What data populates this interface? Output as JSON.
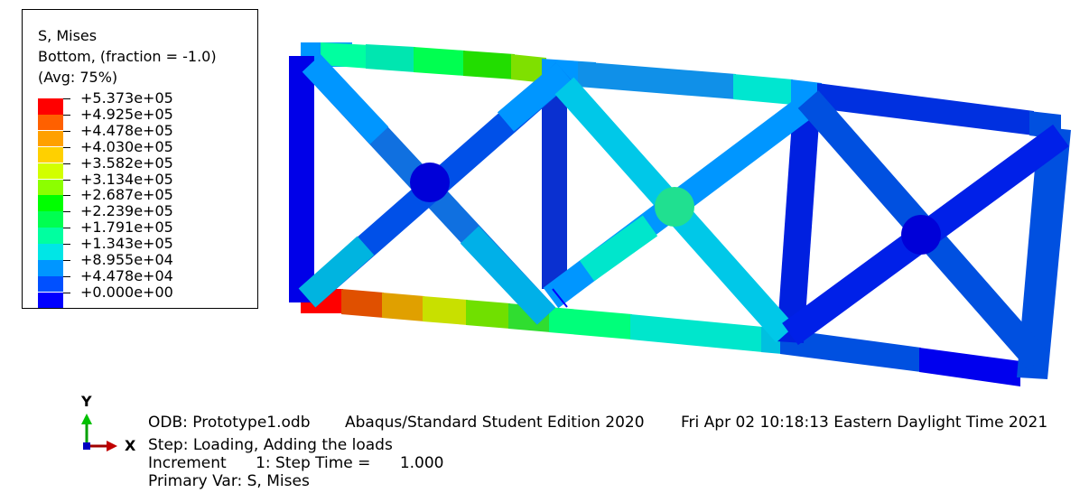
{
  "legend": {
    "title": "S, Mises",
    "subtitle": "Bottom, (fraction = -1.0)",
    "averaging": "(Avg: 75%)",
    "values": [
      "+5.373e+05",
      "+4.925e+05",
      "+4.478e+05",
      "+4.030e+05",
      "+3.582e+05",
      "+3.134e+05",
      "+2.687e+05",
      "+2.239e+05",
      "+1.791e+05",
      "+1.343e+05",
      "+8.955e+04",
      "+4.478e+04",
      "+0.000e+00"
    ],
    "colors": [
      "#ff0000",
      "#ff6000",
      "#ffa000",
      "#ffd000",
      "#d2ff00",
      "#8cff00",
      "#00ff00",
      "#00ff50",
      "#00ffa0",
      "#00e6e6",
      "#0096ff",
      "#0050ff",
      "#0000ff"
    ]
  },
  "triad": {
    "y": "Y",
    "x": "X"
  },
  "info": {
    "odb": "ODB: Prototype1.odb",
    "edition": "Abaqus/Standard Student Edition 2020",
    "date": "Fri Apr 02 10:18:13 Eastern Daylight Time 2021",
    "step": "Step: Loading, Adding the loads",
    "increment": "Increment      1: Step Time =      1.000",
    "primary_var": "Primary Var: S, Mises"
  }
}
